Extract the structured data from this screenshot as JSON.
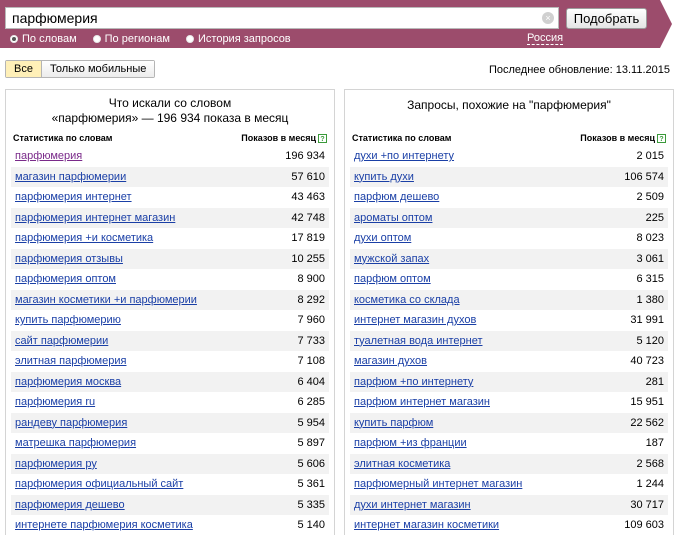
{
  "search": {
    "query": "парфюмерия",
    "submit_label": "Подобрать",
    "clear_symbol": "×"
  },
  "modes": [
    {
      "label": "По словам",
      "selected": true
    },
    {
      "label": "По регионам",
      "selected": false
    },
    {
      "label": "История запросов",
      "selected": false
    }
  ],
  "region": "Россия",
  "tabs": [
    {
      "label": "Все",
      "active": true
    },
    {
      "label": "Только мобильные",
      "active": false
    }
  ],
  "last_update": "Последнее обновление: 13.11.2015",
  "left_panel": {
    "title_line1": "Что искали со словом",
    "title_line2": "«парфюмерия» — 196 934 показа в месяц",
    "col_keyword": "Статистика по словам",
    "col_shows": "Показов в месяц",
    "rows": [
      {
        "kw": "парфюмерия",
        "n": "196 934"
      },
      {
        "kw": "магазин парфюмерии",
        "n": "57 610"
      },
      {
        "kw": "парфюмерия интернет",
        "n": "43 463"
      },
      {
        "kw": "парфюмерия интернет магазин",
        "n": "42 748"
      },
      {
        "kw": "парфюмерия +и косметика",
        "n": "17 819"
      },
      {
        "kw": "парфюмерия отзывы",
        "n": "10 255"
      },
      {
        "kw": "парфюмерия оптом",
        "n": "8 900"
      },
      {
        "kw": "магазин косметики +и парфюмерии",
        "n": "8 292"
      },
      {
        "kw": "купить парфюмерию",
        "n": "7 960"
      },
      {
        "kw": "сайт парфюмерии",
        "n": "7 733"
      },
      {
        "kw": "элитная парфюмерия",
        "n": "7 108"
      },
      {
        "kw": "парфюмерия москва",
        "n": "6 404"
      },
      {
        "kw": "парфюмерия ru",
        "n": "6 285"
      },
      {
        "kw": "рандеву парфюмерия",
        "n": "5 954"
      },
      {
        "kw": "матрешка парфюмерия",
        "n": "5 897"
      },
      {
        "kw": "парфюмерия ру",
        "n": "5 606"
      },
      {
        "kw": "парфюмерия официальный сайт",
        "n": "5 361"
      },
      {
        "kw": "парфюмерия дешево",
        "n": "5 335"
      },
      {
        "kw": "интернете парфюмерия косметика",
        "n": "5 140"
      }
    ]
  },
  "right_panel": {
    "title": "Запросы, похожие на \"парфюмерия\"",
    "col_keyword": "Статистика по словам",
    "col_shows": "Показов в месяц",
    "rows": [
      {
        "kw": "духи +по интернету",
        "n": "2 015"
      },
      {
        "kw": "купить духи",
        "n": "106 574"
      },
      {
        "kw": "парфюм дешево",
        "n": "2 509"
      },
      {
        "kw": "ароматы оптом",
        "n": "225"
      },
      {
        "kw": "духи оптом",
        "n": "8 023"
      },
      {
        "kw": "мужской запах",
        "n": "3 061"
      },
      {
        "kw": "парфюм оптом",
        "n": "6 315"
      },
      {
        "kw": "косметика со склада",
        "n": "1 380"
      },
      {
        "kw": "интернет магазин духов",
        "n": "31 991"
      },
      {
        "kw": "туалетная вода интернет",
        "n": "5 120"
      },
      {
        "kw": "магазин духов",
        "n": "40 723"
      },
      {
        "kw": "парфюм +по интернету",
        "n": "281"
      },
      {
        "kw": "парфюм интернет магазин",
        "n": "15 951"
      },
      {
        "kw": "купить парфюм",
        "n": "22 562"
      },
      {
        "kw": "парфюм +из франции",
        "n": "187"
      },
      {
        "kw": "элитная косметика",
        "n": "2 568"
      },
      {
        "kw": "парфюмерный интернет магазин",
        "n": "1 244"
      },
      {
        "kw": "духи интернет магазин",
        "n": "30 717"
      },
      {
        "kw": "интернет магазин косметики",
        "n": "109 603"
      }
    ]
  },
  "colors": {
    "header_bg": "#9c4c6c",
    "link": "#1a3fa6",
    "visited_link": "#7a2a8a",
    "active_tab": "#fff0b8",
    "help_icon": "#3a9a3a"
  }
}
